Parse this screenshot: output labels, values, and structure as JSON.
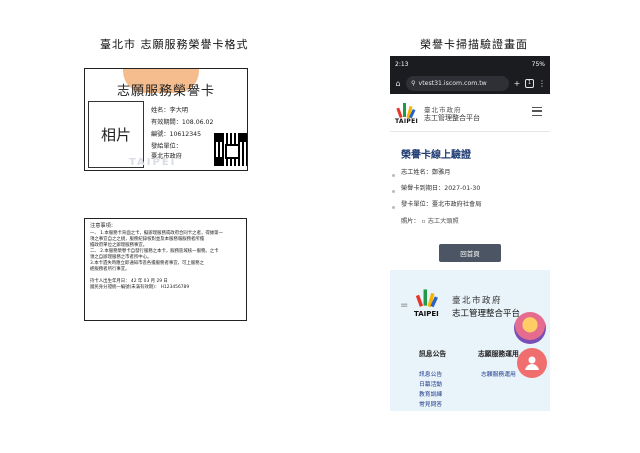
{
  "headings": {
    "left": "臺北市 志願服務榮譽卡格式",
    "right": "榮譽卡掃描驗證畫面"
  },
  "card_front": {
    "title": "志願服務榮譽卡",
    "photo_label": "相片",
    "name": "姓名：李大明",
    "valid": "有效期間：108.06.02",
    "number": "編號：10612345",
    "unit_label": "發給單位：",
    "unit_value": "臺北市政府",
    "watermark": "TAIPEI"
  },
  "card_back": {
    "title": "注意事項：",
    "lines": [
      "一、 1.本服務卡背面之卡，擬辦理服務或政府合同卡之者，得據第一",
      "     項之事宜自之之規，服務紀錄核對並及本服務報服務者所擔",
      "     擔政府單位之辦理服務事宜。",
      "二、 2.本服務榮譽卡自發行服務之本卡，服務區域核一服務。之卡",
      "     領之自辦理服務之市者所中心。",
      "     3.本卡遺失時應立即通知市區各擔服務者事宜，可上服務之",
      "     經服務者所行事宜。"
    ],
    "holder_line": "持卡人出生年月日：  42 年 03 月 29 日",
    "id_line": "國民身分證統一編號(未滿有效期)：  H123456789"
  },
  "phone": {
    "status_time": "2:13",
    "status_right": "75%",
    "url": "vtest31.iscom.com.tw",
    "tab_count": "1",
    "logo_text": "TAIPEI",
    "site_name1": "臺北市政府",
    "site_name2": "志工管理整合平台",
    "verify_title": "榮譽卡線上驗證",
    "field_name": "志工姓名：鄭雅月",
    "field_expiry": "榮譽卡到期日：2027-01-30",
    "field_unit": "發卡單位：臺北市政府社會局",
    "field_photo": "照片：",
    "photo_alt": "志工大頭照",
    "home_button": "回首頁",
    "footer_logo_text": "TAIPEI",
    "footer_name1": "臺北市政府",
    "footer_name2": "志工管理整合平台",
    "footer_col1_heading": "訊息公告",
    "footer_col2_heading": "志願服務運用",
    "footer_col1_links": [
      "訊息公告",
      "日幕活動",
      "教育訓練",
      "常見問答"
    ],
    "footer_col2_links": [
      "志願服務運用"
    ]
  },
  "colors": {
    "verify_title": "#1f3d73",
    "home_button": "#4b5563",
    "footer_bg": "#e9f3fa",
    "card_accent": "#f3b27a"
  },
  "icons": [
    "home-icon",
    "lock-icon",
    "plus-icon",
    "menu-dots-icon",
    "hamburger-icon",
    "chat-icon",
    "qr-code-icon"
  ]
}
